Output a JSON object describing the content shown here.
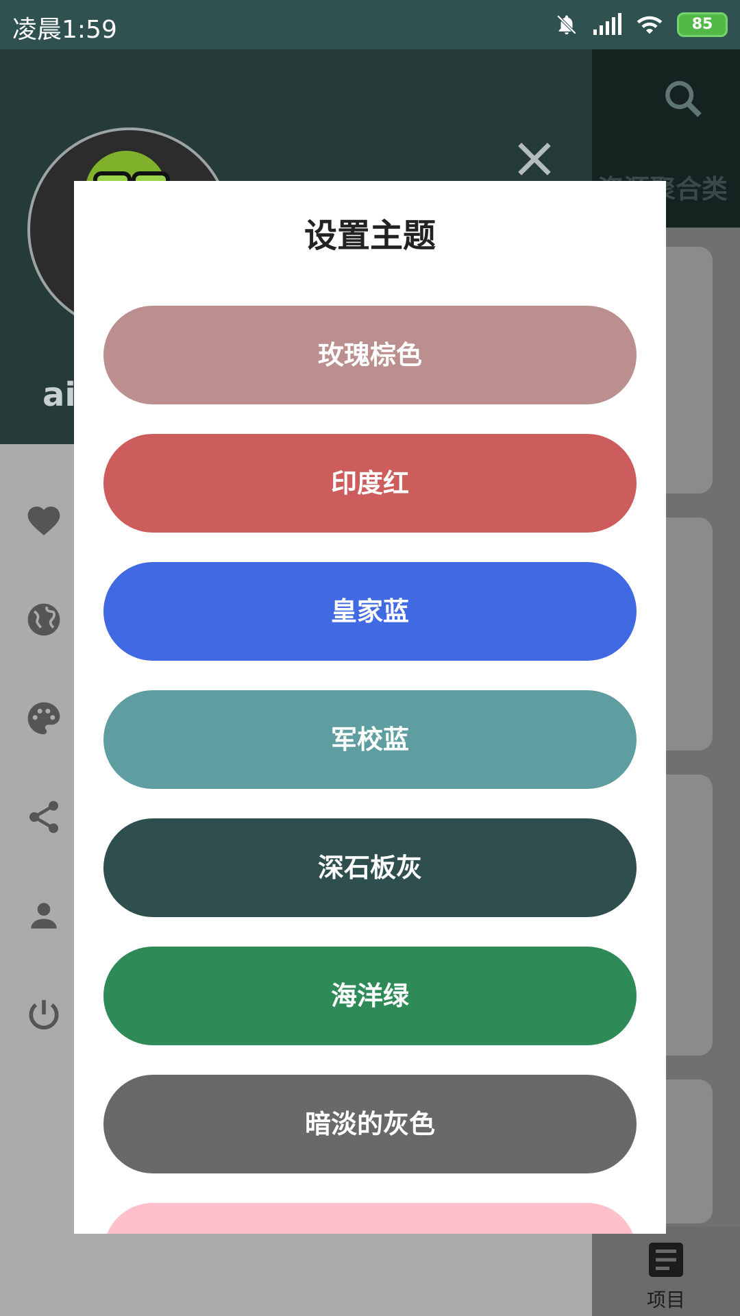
{
  "status_bar": {
    "time": "凌晨1:59",
    "battery": "85",
    "icons": [
      "bell-muted-icon",
      "signal-icon",
      "wifi-icon",
      "battery-icon"
    ]
  },
  "background": {
    "toolbar_title": "资源聚合类",
    "bottom_tab_label": "项目",
    "drawer_user_name": "ai"
  },
  "drawer_menu": [
    "heart-icon",
    "globe-icon",
    "palette-icon",
    "share-icon",
    "person-icon",
    "power-icon"
  ],
  "dialog": {
    "title": "设置主题",
    "themes": [
      {
        "label": "玫瑰棕色",
        "color": "#bc8f8f"
      },
      {
        "label": "印度红",
        "color": "#cd5c5c"
      },
      {
        "label": "皇家蓝",
        "color": "#4169e1"
      },
      {
        "label": "军校蓝",
        "color": "#5f9ea0"
      },
      {
        "label": "深石板灰",
        "color": "#2f4f4f"
      },
      {
        "label": "海洋绿",
        "color": "#2e8b57"
      },
      {
        "label": "暗淡的灰色",
        "color": "#696969"
      },
      {
        "label": "",
        "color": "#ffc0cb"
      }
    ]
  }
}
